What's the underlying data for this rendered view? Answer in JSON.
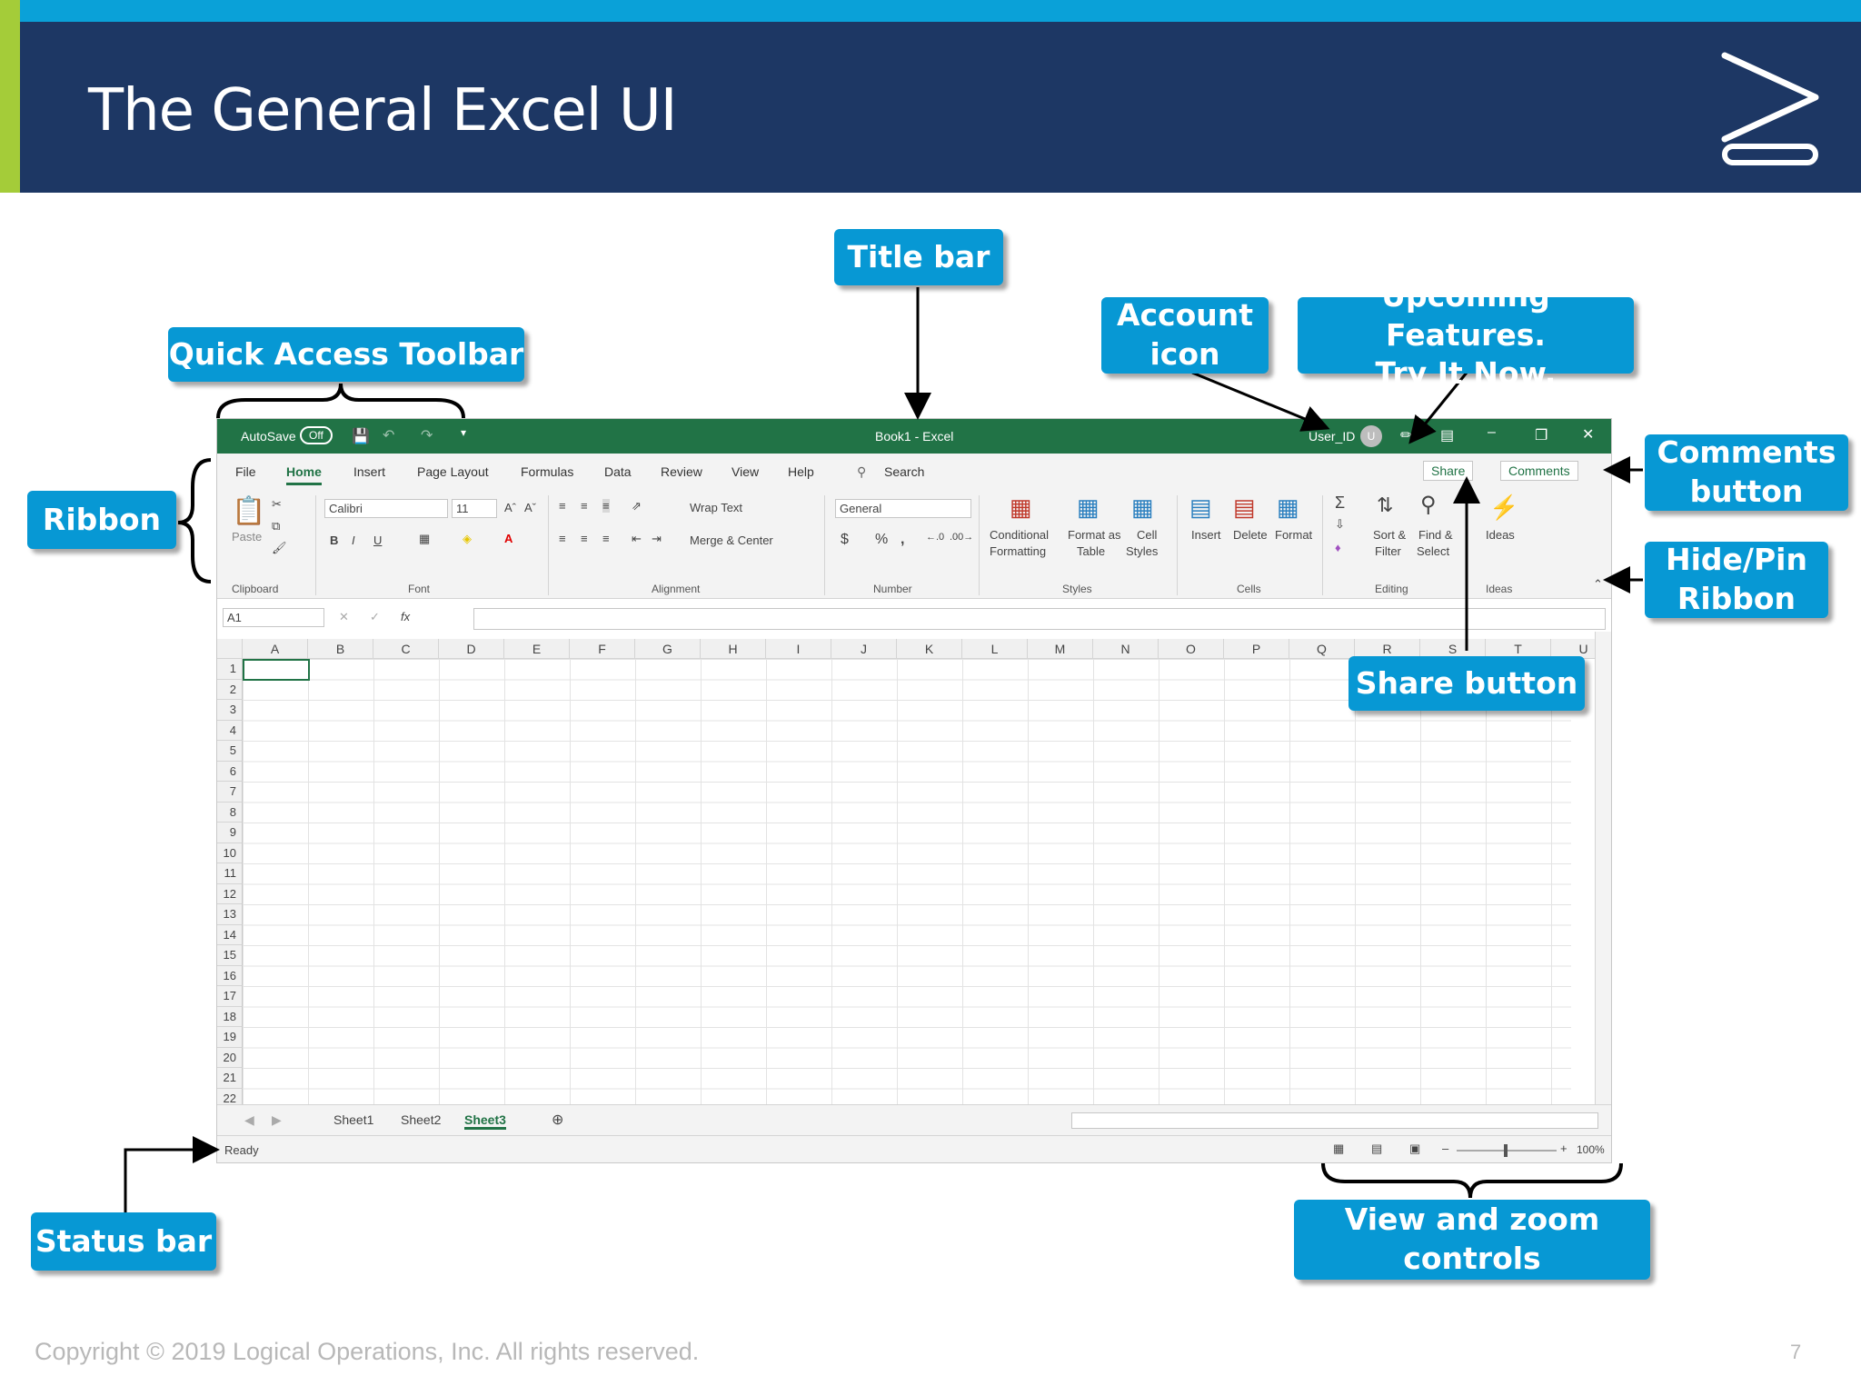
{
  "slide": {
    "title": "The General Excel UI",
    "copyright": "Copyright © 2019 Logical Operations, Inc. All rights reserved.",
    "page_number": "7"
  },
  "callouts": {
    "title_bar": "Title bar",
    "quick_access": "Quick Access Toolbar",
    "account_icon": "Account\nicon",
    "upcoming": "Upcoming Features.\nTry It Now.",
    "comments_button": "Comments\nbutton",
    "hide_pin": "Hide/Pin\nRibbon",
    "ribbon": "Ribbon",
    "share_button": "Share button",
    "status_bar": "Status bar",
    "view_zoom": "View and zoom\ncontrols"
  },
  "excel": {
    "titlebar": {
      "autosave": "AutoSave",
      "autosave_state": "Off",
      "doc_title": "Book1  -  Excel",
      "user_id": "User_ID",
      "avatar_letter": "U"
    },
    "tabs": [
      "File",
      "Home",
      "Insert",
      "Page Layout",
      "Formulas",
      "Data",
      "Review",
      "View",
      "Help"
    ],
    "search": "Search",
    "share": "Share",
    "comments": "Comments",
    "ribbon": {
      "paste": "Paste",
      "font_name": "Calibri",
      "font_size": "11",
      "wrap_text": "Wrap Text",
      "merge_center": "Merge & Center",
      "number_format": "General",
      "conditional": "Conditional",
      "formatting": "Formatting",
      "format_as": "Format as",
      "table": "Table",
      "cell": "Cell",
      "styles_label": "Styles",
      "insert": "Insert",
      "delete": "Delete",
      "format": "Format",
      "sort": "Sort &",
      "filter": "Filter",
      "find": "Find &",
      "select": "Select",
      "ideas": "Ideas",
      "groups": [
        "Clipboard",
        "Font",
        "Alignment",
        "Number",
        "Styles",
        "Cells",
        "Editing",
        "Ideas"
      ]
    },
    "namebox": "A1",
    "columns": [
      "A",
      "B",
      "C",
      "D",
      "E",
      "F",
      "G",
      "H",
      "I",
      "J",
      "K",
      "L",
      "M",
      "N",
      "O",
      "P",
      "Q",
      "R",
      "S",
      "T",
      "U"
    ],
    "rows": [
      "1",
      "2",
      "3",
      "4",
      "5",
      "6",
      "7",
      "8",
      "9",
      "10",
      "11",
      "12",
      "13",
      "14",
      "15",
      "16",
      "17",
      "18",
      "19",
      "20",
      "21",
      "22"
    ],
    "sheets": [
      "Sheet1",
      "Sheet2",
      "Sheet3"
    ],
    "status": "Ready",
    "zoom": "100%"
  }
}
